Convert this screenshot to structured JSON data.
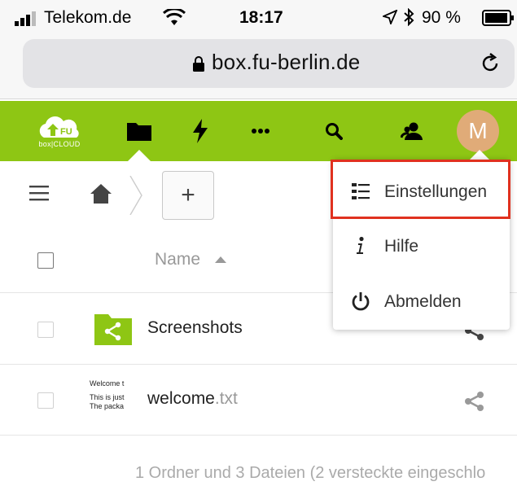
{
  "statusbar": {
    "carrier": "Telekom.de",
    "time": "18:17",
    "battery": "90 %"
  },
  "browser": {
    "url": "box.fu-berlin.de"
  },
  "app": {
    "logo_text": "box|CLOUD",
    "brand_color": "#8ec614",
    "nav_icons": [
      "files-icon",
      "activity-icon",
      "more-apps-icon",
      "search-icon",
      "contacts-icon"
    ],
    "avatar_initial": "M",
    "avatar_color": "#e0ab78"
  },
  "controls": {
    "add_label": "+"
  },
  "list": {
    "column_name": "Name",
    "rows": [
      {
        "type": "folder",
        "name": "Screenshots",
        "ext": ""
      },
      {
        "type": "file",
        "name": "welcome",
        "ext": ".txt",
        "thumb_lines": [
          "Welcome t",
          "This is just",
          "The packa"
        ]
      }
    ],
    "summary": "1 Ordner und 3 Dateien (2 versteckte eingeschlo"
  },
  "menu": {
    "items": [
      {
        "label": "Einstellungen",
        "icon": "settings-list-icon"
      },
      {
        "label": "Hilfe",
        "icon": "info-icon"
      },
      {
        "label": "Abmelden",
        "icon": "power-icon"
      }
    ],
    "highlight_color": "#e0311f"
  }
}
